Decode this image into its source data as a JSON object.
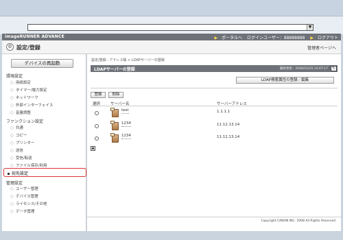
{
  "browser": {
    "address_value": "",
    "dropdown_glyph": "▼"
  },
  "header": {
    "brand": "imageRUNNER ADVANCE",
    "portal_link": "ポータルへ",
    "login_user": "ログインユーザー：88888888",
    "logout_link": "ログアウト"
  },
  "titlebar": {
    "title": "設定/登録",
    "icon": "settings-icon",
    "to_management": "管理者ページへ"
  },
  "sidebar": {
    "restart_button": "デバイスの再起動",
    "groups": {
      "environment": "環境設定",
      "function": "ファンクション設定",
      "management": "管理設定"
    },
    "environment_items": [
      "用紙設定",
      "タイマー/電力設定",
      "ネットワーク",
      "外部インターフェイス",
      "音量調整"
    ],
    "function_items": [
      "共通",
      "コピー",
      "プリンター",
      "送信",
      "受信/転送",
      "ファイル保存/利用"
    ],
    "selected_item": "宛先設定",
    "management_items": [
      "ユーザー管理",
      "デバイス管理",
      "ライセンス/その他",
      "データ管理"
    ]
  },
  "main": {
    "breadcrumb": "設定/登録 : アドレス帳 > LDAPサーバーの登録",
    "panel_title": "LDAPサーバーの登録",
    "last_updated": "最終更新：2008/10/20 14:07:17",
    "register_attr_button": "LDAP検索属性の登録／編集",
    "register_button": "登録",
    "delete_button": "削除",
    "columns": {
      "select": "選択",
      "server_name": "サーバー名",
      "server_address": "サーバーアドレス"
    },
    "rows": [
      {
        "name": "test",
        "address": "1.1.1.1"
      },
      {
        "name": "1234",
        "address": "11.12.13.14"
      },
      {
        "name": "1234",
        "address": "11.12.13.14"
      }
    ]
  },
  "footer": {
    "copyright": "Copyright CANON INC. 2008 All Rights Reserved"
  },
  "colors": {
    "header_bg": "#6e7278",
    "highlight_border": "#dd3333",
    "brand_arrow": "#ffd84a"
  }
}
